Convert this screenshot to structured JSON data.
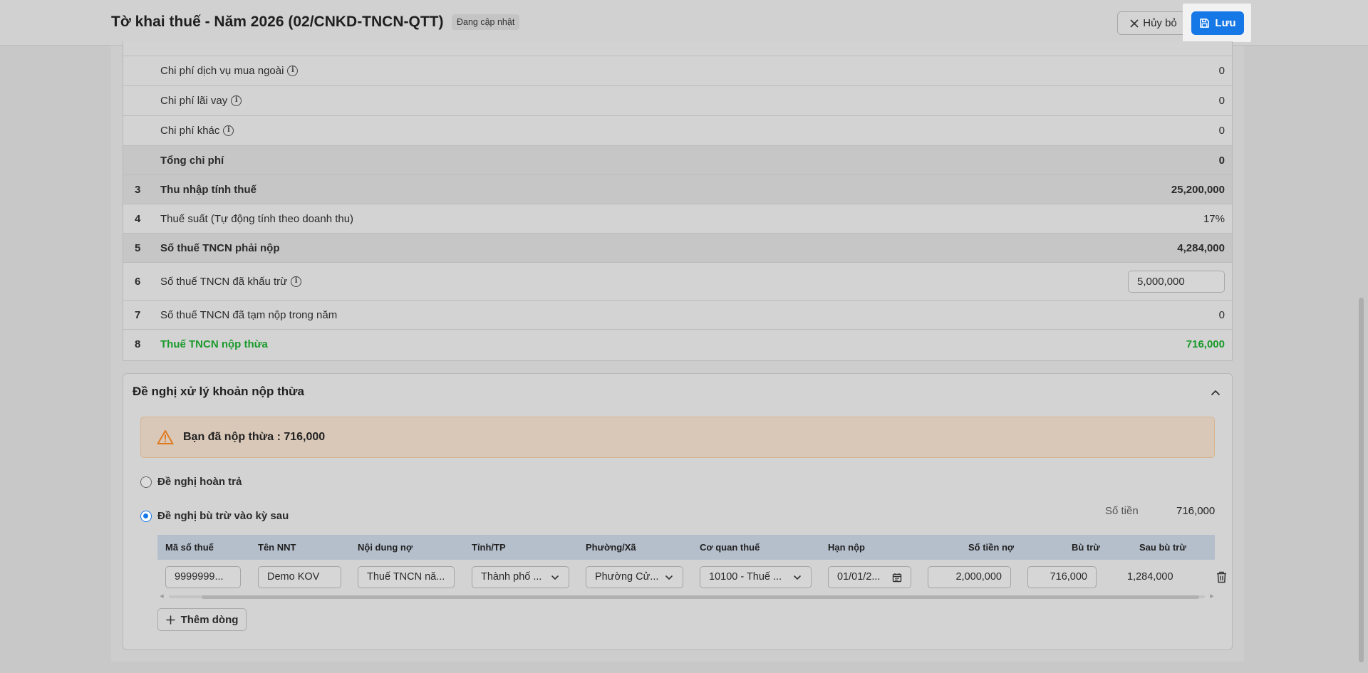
{
  "header": {
    "title": "Tờ khai thuế - Năm 2026 (02/CNKD-TNCN-QTT)",
    "status_badge": "Đang cập nhật",
    "cancel_label": "Hủy bỏ",
    "save_label": "Lưu"
  },
  "table": {
    "rows": [
      {
        "num": "",
        "label": "Chi phí dịch vụ mua ngoài",
        "value": "0",
        "info": true
      },
      {
        "num": "",
        "label": "Chi phí lãi vay",
        "value": "0",
        "info": true
      },
      {
        "num": "",
        "label": "Chi phí khác",
        "value": "0",
        "info": true
      },
      {
        "num": "",
        "label": "Tổng chi phí",
        "value": "0"
      },
      {
        "num": "3",
        "label": "Thu nhập tính thuế",
        "value": "25,200,000"
      },
      {
        "num": "4",
        "label": "Thuế suất (Tự động tính theo doanh thu)",
        "value": "17%"
      },
      {
        "num": "5",
        "label": "Số thuế TNCN phải nộp",
        "value": "4,284,000"
      },
      {
        "num": "6",
        "label": "Số thuế TNCN đã khấu trừ",
        "value": "5,000,000",
        "info": true
      },
      {
        "num": "7",
        "label": "Số thuế TNCN đã tạm nộp trong năm",
        "value": "0"
      },
      {
        "num": "8",
        "label": "Thuế TNCN nộp thừa",
        "value": "716,000"
      }
    ]
  },
  "proposal": {
    "title": "Đề nghị xử lý khoản nộp thừa",
    "alert_text": "Bạn đã nộp thừa : 716,000",
    "option_refund": "Đề nghị hoàn trả",
    "option_offset": "Đề nghị bù trừ vào kỳ sau",
    "amount_label": "Số tiền",
    "amount_value": "716,000",
    "columns": [
      "Mã số thuế",
      "Tên NNT",
      "Nội dung nợ",
      "Tỉnh/TP",
      "Phường/Xã",
      "Cơ quan thuế",
      "Hạn nộp",
      "Số tiền nợ",
      "Bù trừ",
      "Sau bù trừ"
    ],
    "row": {
      "tax_code": "9999999...",
      "taxpayer_name": "Demo KOV",
      "debt_content": "Thuế TNCN nă...",
      "province": "Thành phố ...",
      "ward": "Phường Cử...",
      "tax_office": "10100 - Thuế ...",
      "due_date": "01/01/2...",
      "debt_amount": "2,000,000",
      "offset": "716,000",
      "after_offset": "1,284,000"
    },
    "add_row_label": "Thêm dòng"
  },
  "colors": {
    "primary": "#1677e6",
    "success": "#1a9a2a",
    "warning": "#e07a1f"
  }
}
